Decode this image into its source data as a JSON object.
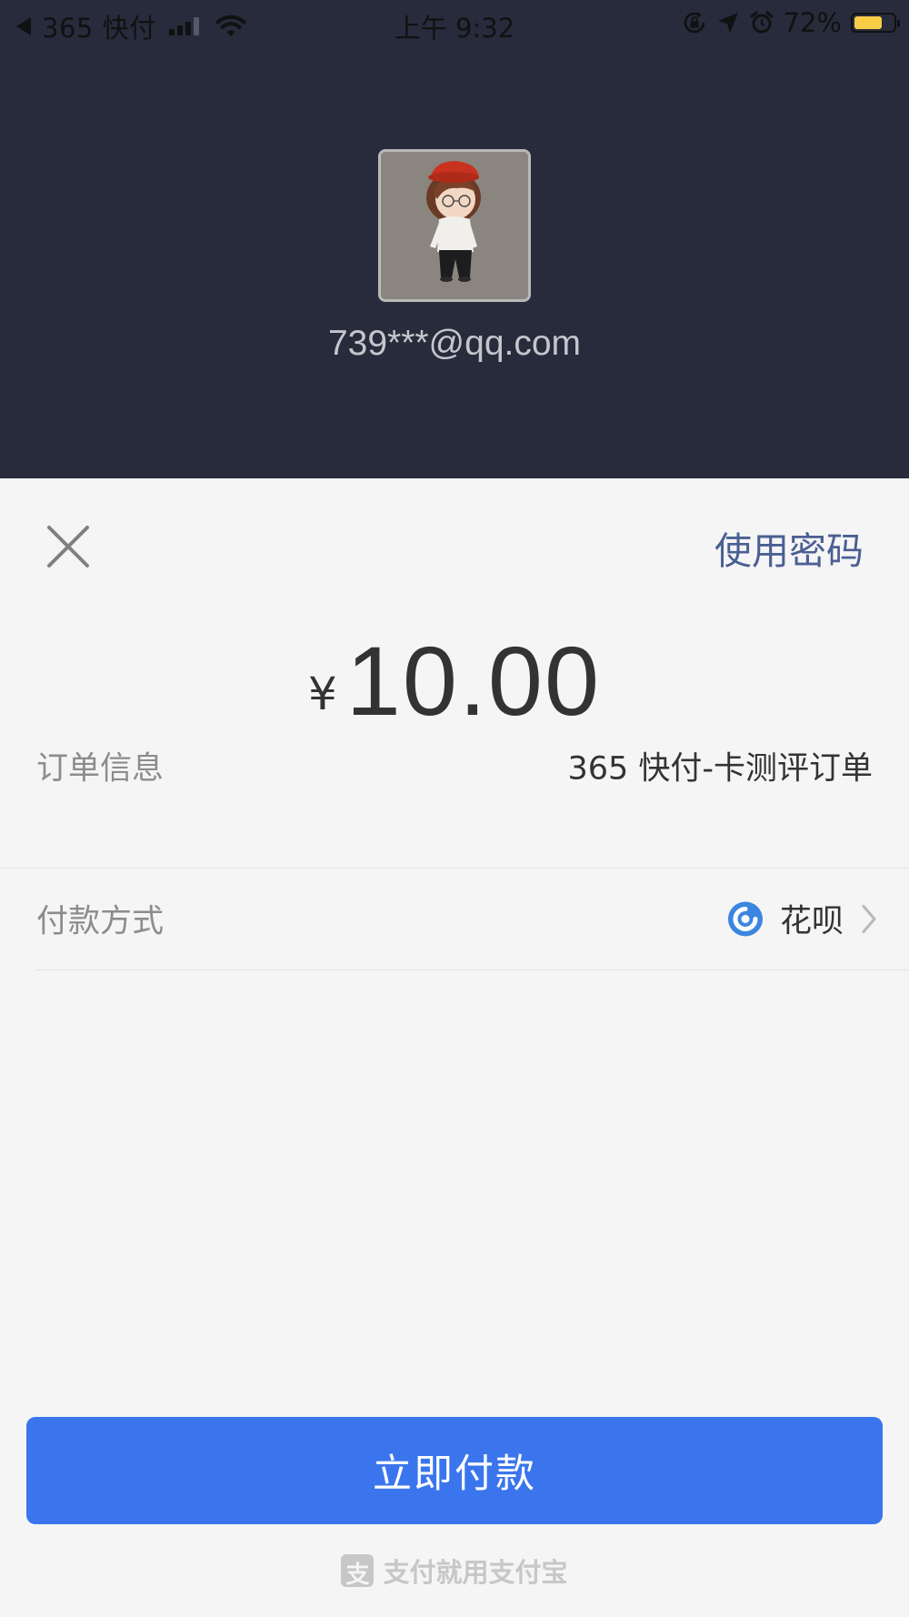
{
  "status_bar": {
    "carrier": "365 快付",
    "time": "上午 9:32",
    "battery": "72%",
    "battery_level": 0.72,
    "battery_color": "#f7cd46"
  },
  "header": {
    "account": "739***@qq.com"
  },
  "sheet": {
    "close_icon": "close-icon",
    "use_password": "使用密码"
  },
  "payment": {
    "currency": "¥",
    "amount": "10.00"
  },
  "order_info": {
    "label": "订单信息",
    "value": "365 快付-卡测评订单"
  },
  "payment_method": {
    "label": "付款方式",
    "value": "花呗",
    "icon": "huabei-icon",
    "icon_color": "#3c86e0"
  },
  "pay_button": {
    "label": "立即付款",
    "color": "#3a75ed"
  },
  "footer": {
    "logo_glyph": "支",
    "slogan": "支付就用支付宝"
  }
}
